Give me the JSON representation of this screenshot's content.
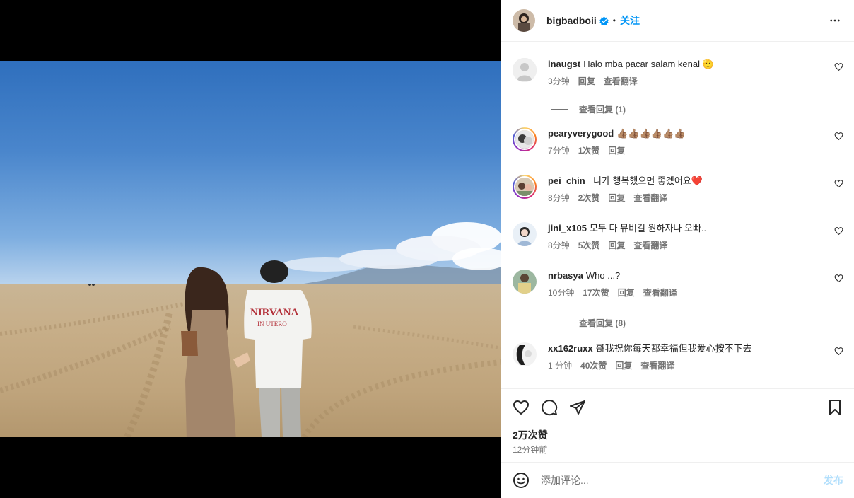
{
  "header": {
    "username": "bigbadboii",
    "follow_label": "关注",
    "separator": "•"
  },
  "comments": [
    {
      "username": "inaugst",
      "text": "Halo mba pacar salam kenal 🫡",
      "time": "3分钟",
      "likes": "",
      "reply": "回复",
      "translate": "查看翻译"
    },
    {
      "username": "pearyverygood",
      "text": "👍🏽👍🏽👍🏽👍🏽👍🏽👍🏽",
      "time": "7分钟",
      "likes": "1次赞",
      "reply": "回复",
      "translate": ""
    },
    {
      "username": "pei_chin_",
      "text": "니가 행복했으면 좋겠어요❤️",
      "time": "8分钟",
      "likes": "2次赞",
      "reply": "回复",
      "translate": "查看翻译"
    },
    {
      "username": "jini_x105",
      "text": "모두 다 뮤비길 원하자나 오빠..",
      "time": "8分钟",
      "likes": "5次赞",
      "reply": "回复",
      "translate": "查看翻译"
    },
    {
      "username": "nrbasya",
      "text": "Who ...?",
      "time": "10分钟",
      "likes": "17次赞",
      "reply": "回复",
      "translate": "查看翻译"
    },
    {
      "username": "xx162ruxx",
      "text": "哥我祝你每天都幸福但我爱心按不下去",
      "time": "1 分钟",
      "likes": "40次赞",
      "reply": "回复",
      "translate": "查看翻译"
    }
  ],
  "view_replies": [
    "查看回复 (1)",
    "查看回复 (8)"
  ],
  "post_stats": {
    "likes": "2万次赞",
    "time": "12分钟前"
  },
  "comment_box": {
    "placeholder": "添加评论...",
    "post_label": "发布"
  },
  "icons": {
    "more": "more-horizontal-icon",
    "like": "heart-icon",
    "comment": "comment-icon",
    "share": "share-icon",
    "save": "bookmark-icon",
    "emoji": "emoji-icon",
    "verified": "verified-badge-icon"
  },
  "colors": {
    "accent": "#0095f6",
    "secondary_text": "#737373",
    "post_disabled": "#b2dffc"
  }
}
